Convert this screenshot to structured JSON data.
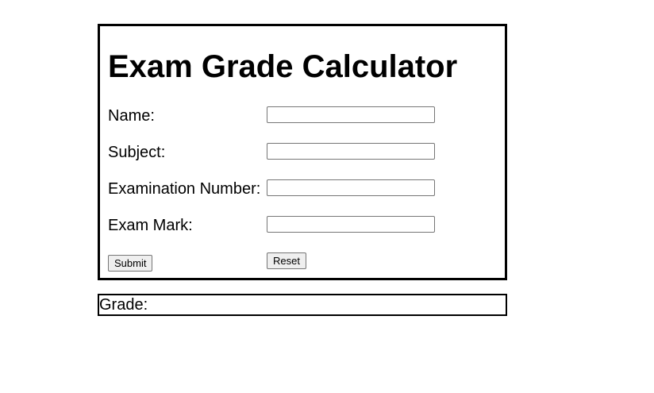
{
  "form": {
    "title": "Exam Grade Calculator",
    "fields": [
      {
        "label": "Name:",
        "value": "",
        "placeholder": ""
      },
      {
        "label": "Subject:",
        "value": "",
        "placeholder": ""
      },
      {
        "label": "Examination Number:",
        "value": "",
        "placeholder": ""
      },
      {
        "label": "Exam Mark:",
        "value": "",
        "placeholder": ""
      }
    ],
    "submit_label": "Submit",
    "reset_label": "Reset"
  },
  "result": {
    "grade_label": "Grade:",
    "grade_value": ""
  }
}
